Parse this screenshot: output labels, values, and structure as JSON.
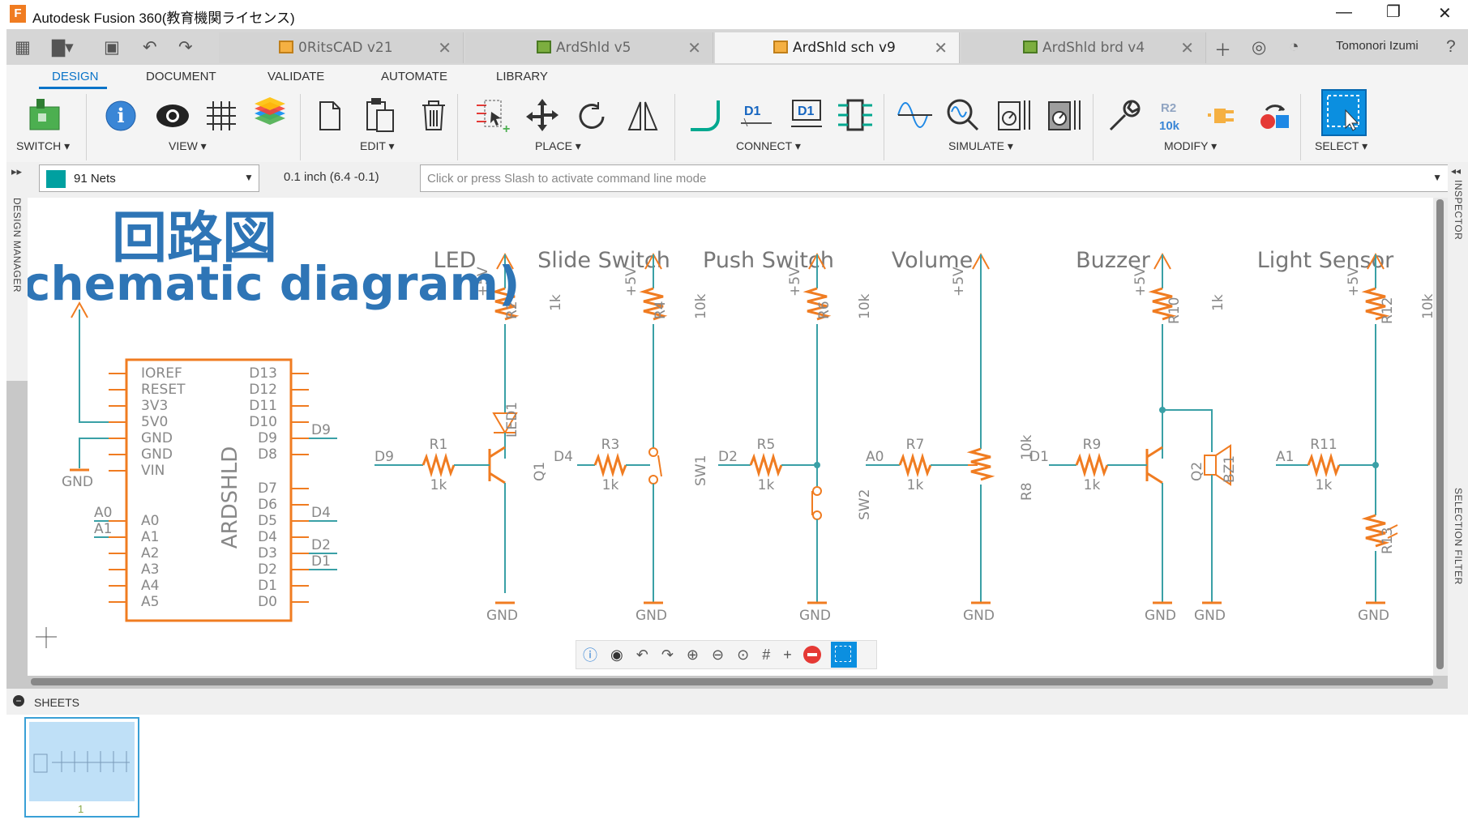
{
  "window": {
    "title": "Autodesk Fusion 360(教育機関ライセンス)",
    "app_icon_letter": "F"
  },
  "tabs": [
    {
      "label": "0RitsCAD v21",
      "active": false
    },
    {
      "label": "ArdShld v5",
      "active": false
    },
    {
      "label": "ArdShld sch v9",
      "active": true
    },
    {
      "label": "ArdShld brd v4",
      "active": false
    }
  ],
  "user": {
    "name": "Tomonori Izumi"
  },
  "ribbon": {
    "tabs": [
      "DESIGN",
      "DOCUMENT",
      "VALIDATE",
      "AUTOMATE",
      "LIBRARY"
    ],
    "active_tab": "DESIGN",
    "groups": [
      "SWITCH ▾",
      "VIEW ▾",
      "EDIT ▾",
      "PLACE ▾",
      "CONNECT ▾",
      "SIMULATE ▾",
      "MODIFY ▾",
      "SELECT ▾"
    ]
  },
  "command_bar": {
    "net_selector": "91 Nets",
    "grid_readout": "0.1 inch (6.4 -0.1)",
    "command_placeholder": "Click or press Slash to activate command line mode"
  },
  "side_panels": {
    "left": "DESIGN MANAGER",
    "right_top": "INSPECTOR",
    "right_bottom": "SELECTION FILTER"
  },
  "overlay": {
    "title_jp": "回路図",
    "title_en": "chematic diagram)"
  },
  "schematic": {
    "sections": [
      "LED",
      "Slide Switch",
      "Push Switch",
      "Volume",
      "Buzzer",
      "Light Sensor"
    ],
    "arduino": {
      "name": "ARDSHLD",
      "left_pins": [
        "IOREF",
        "RESET",
        "3V3",
        "5V0",
        "GND",
        "GND",
        "VIN",
        "A0",
        "A1",
        "A2",
        "A3",
        "A4",
        "A5"
      ],
      "right_pins": [
        "D13",
        "D12",
        "D11",
        "D10",
        "D9",
        "D8",
        "D7",
        "D6",
        "D5",
        "D4",
        "D3",
        "D2",
        "D1",
        "D0"
      ],
      "nets": [
        "D9",
        "D4",
        "D2",
        "D1",
        "A0",
        "A1",
        "GND"
      ]
    },
    "circuits": [
      {
        "input": "D9",
        "rin": "R1",
        "rin_val": "1k",
        "rtop": "R2",
        "rtop_val": "1k",
        "extra": "LED1",
        "device": "Q1"
      },
      {
        "input": "D4",
        "rin": "R3",
        "rin_val": "1k",
        "rtop": "R4",
        "rtop_val": "10k",
        "device": "SW1"
      },
      {
        "input": "D2",
        "rin": "R5",
        "rin_val": "1k",
        "rtop": "R6",
        "rtop_val": "10k",
        "device": "SW2"
      },
      {
        "input": "A0",
        "rin": "R7",
        "rin_val": "1k",
        "device": "R8",
        "device_val": "10k"
      },
      {
        "input": "D1",
        "rin": "R9",
        "rin_val": "1k",
        "rtop": "R10",
        "rtop_val": "1k",
        "device": "Q2",
        "extra": "BZ1"
      },
      {
        "input": "A1",
        "rin": "R11",
        "rin_val": "1k",
        "rtop": "R12",
        "rtop_val": "10k",
        "device": "R13"
      }
    ],
    "supply_label": "+5V",
    "ground_label": "GND"
  },
  "sheets": {
    "header": "SHEETS",
    "items": [
      "1"
    ]
  }
}
